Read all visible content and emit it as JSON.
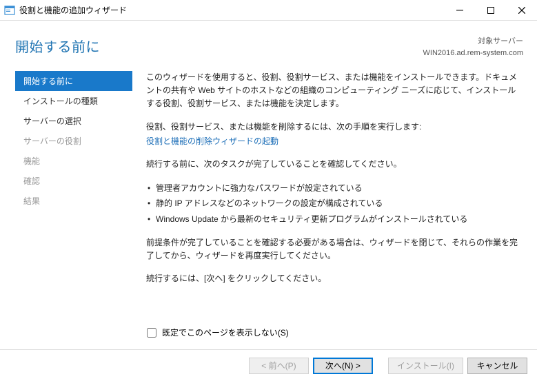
{
  "titlebar": {
    "title": "役割と機能の追加ウィザード"
  },
  "header": {
    "page_title": "開始する前に",
    "target_label": "対象サーバー",
    "target_server": "WIN2016.ad.rem-system.com"
  },
  "sidebar": {
    "items": [
      {
        "label": "開始する前に",
        "state": "active"
      },
      {
        "label": "インストールの種類",
        "state": "enabled"
      },
      {
        "label": "サーバーの選択",
        "state": "enabled"
      },
      {
        "label": "サーバーの役割",
        "state": "disabled"
      },
      {
        "label": "機能",
        "state": "disabled"
      },
      {
        "label": "確認",
        "state": "disabled"
      },
      {
        "label": "結果",
        "state": "disabled"
      }
    ]
  },
  "content": {
    "intro": "このウィザードを使用すると、役割、役割サービス、または機能をインストールできます。ドキュメントの共有や Web サイトのホストなどの組織のコンピューティング ニーズに応じて、インストールする役割、役割サービス、または機能を決定します。",
    "remove_lead": "役割、役割サービス、または機能を削除するには、次の手順を実行します:",
    "remove_link": "役割と機能の削除ウィザードの起動",
    "verify_msg": "続行する前に、次のタスクが完了していることを確認してください。",
    "bullets": [
      "管理者アカウントに強力なパスワードが設定されている",
      "静的 IP アドレスなどのネットワークの設定が構成されている",
      "Windows Update から最新のセキュリティ更新プログラムがインストールされている"
    ],
    "prereq_msg": "前提条件が完了していることを確認する必要がある場合は、ウィザードを閉じて、それらの作業を完了してから、ウィザードを再度実行してください。",
    "continue_msg": "続行するには、[次へ] をクリックしてください。"
  },
  "skip": {
    "label": "既定でこのページを表示しない(S)"
  },
  "footer": {
    "back": "< 前へ(P)",
    "next": "次へ(N) >",
    "install": "インストール(I)",
    "cancel": "キャンセル"
  }
}
